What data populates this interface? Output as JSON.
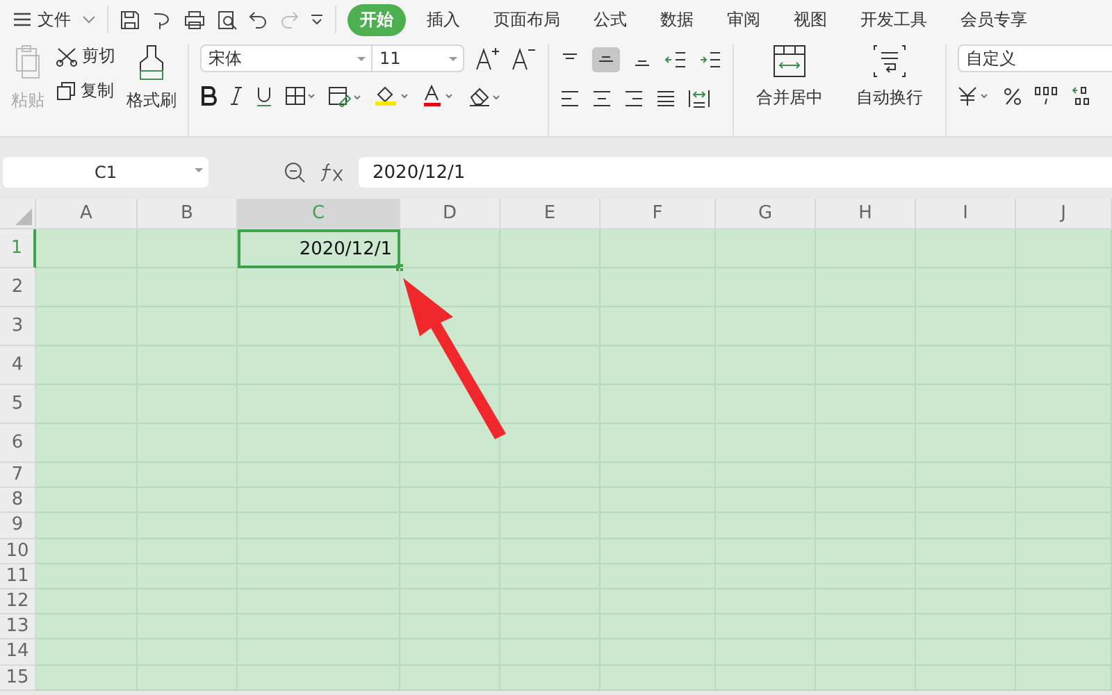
{
  "menu": {
    "file_label": "文件",
    "tabs": [
      {
        "label": "开始",
        "selected": true
      },
      {
        "label": "插入",
        "selected": false
      },
      {
        "label": "页面布局",
        "selected": false
      },
      {
        "label": "公式",
        "selected": false
      },
      {
        "label": "数据",
        "selected": false
      },
      {
        "label": "审阅",
        "selected": false
      },
      {
        "label": "视图",
        "selected": false
      },
      {
        "label": "开发工具",
        "selected": false
      },
      {
        "label": "会员专享",
        "selected": false
      }
    ]
  },
  "ribbon": {
    "paste": {
      "label": "粘贴",
      "disabled": true
    },
    "cut": "剪切",
    "copy": "复制",
    "format_painter": "格式刷",
    "font": "宋体",
    "font_size": "11",
    "align_center_selected": true,
    "merge": "合并居中",
    "wrap": "自动换行",
    "number_format": "自定义"
  },
  "formula_bar": {
    "name_box": "C1",
    "formula": "2020/12/1"
  },
  "sheet": {
    "columns": [
      {
        "label": "A",
        "selected": false
      },
      {
        "label": "B",
        "selected": false
      },
      {
        "label": "C",
        "selected": true,
        "cells": [
          {
            "value": "2020/12/1",
            "selected": true
          }
        ]
      },
      {
        "label": "D",
        "selected": false
      },
      {
        "label": "E",
        "selected": false
      },
      {
        "label": "F",
        "selected": false
      },
      {
        "label": "G",
        "selected": false
      },
      {
        "label": "H",
        "selected": false
      },
      {
        "label": "I",
        "selected": false
      },
      {
        "label": "J",
        "selected": false
      }
    ],
    "rows": [
      {
        "label": "1",
        "selected": true
      },
      {
        "label": "2",
        "selected": false
      },
      {
        "label": "3",
        "selected": false
      },
      {
        "label": "4",
        "selected": false
      },
      {
        "label": "5",
        "selected": false
      },
      {
        "label": "6",
        "selected": false
      },
      {
        "label": "7",
        "selected": false
      },
      {
        "label": "8",
        "selected": false
      },
      {
        "label": "9",
        "selected": false
      },
      {
        "label": "10",
        "selected": false
      },
      {
        "label": "11",
        "selected": false
      },
      {
        "label": "12",
        "selected": false
      },
      {
        "label": "13",
        "selected": false
      },
      {
        "label": "14",
        "selected": false
      },
      {
        "label": "15",
        "selected": false
      }
    ]
  }
}
